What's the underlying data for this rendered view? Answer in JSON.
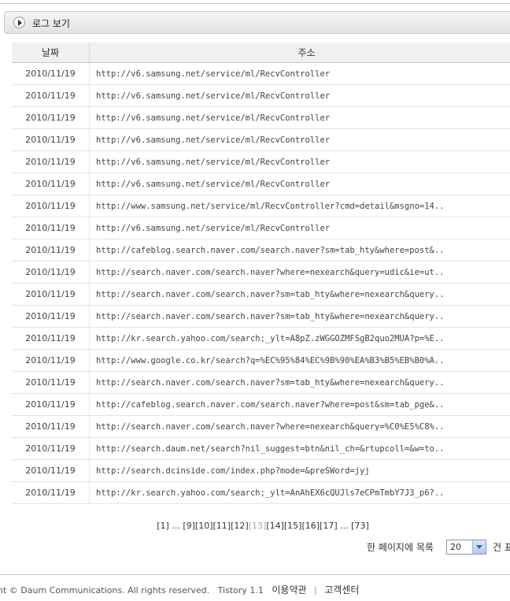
{
  "panel": {
    "title": "로그 보기"
  },
  "table": {
    "headers": {
      "date": "날짜",
      "url": "주소"
    },
    "rows": [
      {
        "date": "2010/11/19",
        "url": "http://v6.samsung.net/service/ml/RecvController"
      },
      {
        "date": "2010/11/19",
        "url": "http://v6.samsung.net/service/ml/RecvController"
      },
      {
        "date": "2010/11/19",
        "url": "http://v6.samsung.net/service/ml/RecvController"
      },
      {
        "date": "2010/11/19",
        "url": "http://v6.samsung.net/service/ml/RecvController"
      },
      {
        "date": "2010/11/19",
        "url": "http://v6.samsung.net/service/ml/RecvController"
      },
      {
        "date": "2010/11/19",
        "url": "http://v6.samsung.net/service/ml/RecvController"
      },
      {
        "date": "2010/11/19",
        "url": "http://www.samsung.net/service/ml/RecvController?cmd=detail&msgno=14.."
      },
      {
        "date": "2010/11/19",
        "url": "http://v6.samsung.net/service/ml/RecvController"
      },
      {
        "date": "2010/11/19",
        "url": "http://cafeblog.search.naver.com/search.naver?sm=tab_hty&where=post&.."
      },
      {
        "date": "2010/11/19",
        "url": "http://search.naver.com/search.naver?where=nexearch&query=udic&ie=ut.."
      },
      {
        "date": "2010/11/19",
        "url": "http://search.naver.com/search.naver?sm=tab_hty&where=nexearch&query.."
      },
      {
        "date": "2010/11/19",
        "url": "http://search.naver.com/search.naver?sm=tab_hty&where=nexearch&query.."
      },
      {
        "date": "2010/11/19",
        "url": "http://kr.search.yahoo.com/search;_ylt=A8pZ.zWGGOZMFSgB2quo2MUA?p=%E.."
      },
      {
        "date": "2010/11/19",
        "url": "http://www.google.co.kr/search?q=%EC%95%84%EC%9B%90%EA%B3%B5%EB%B0%A.."
      },
      {
        "date": "2010/11/19",
        "url": "http://search.naver.com/search.naver?sm=tab_hty&where=nexearch&query.."
      },
      {
        "date": "2010/11/19",
        "url": "http://cafeblog.search.naver.com/search.naver?where=post&sm=tab_pge&.."
      },
      {
        "date": "2010/11/19",
        "url": "http://search.naver.com/search.naver?where=nexearch&query=%C0%E5%C8%.."
      },
      {
        "date": "2010/11/19",
        "url": "http://search.daum.net/search?nil_suggest=btn&nil_ch=&rtupcoll=&w=to.."
      },
      {
        "date": "2010/11/19",
        "url": "http://search.dcinside.com/index.php?mode=&preSWord=jyj"
      },
      {
        "date": "2010/11/19",
        "url": "http://kr.search.yahoo.com/search;_ylt=AnAhEX6cQUJls7eCPmTmbY7J3_p6?.."
      }
    ]
  },
  "pagination": {
    "first": "[1]",
    "ellipsis1": "...",
    "pages": [
      "[9]",
      "[10]",
      "[11]",
      "[12]",
      "[13]",
      "[14]",
      "[15]",
      "[16]",
      "[17]"
    ],
    "current": "[13]",
    "ellipsis2": "...",
    "last": "[73]"
  },
  "per_page": {
    "label_before": "한 페이지에 목록",
    "value": "20",
    "label_after": "건 표"
  },
  "footer": {
    "copyright": "nt © Daum Communications. All rights reserved.",
    "version": "Tistory 1.1",
    "terms": "이용약관",
    "divider": "|",
    "support": "고객센터"
  }
}
